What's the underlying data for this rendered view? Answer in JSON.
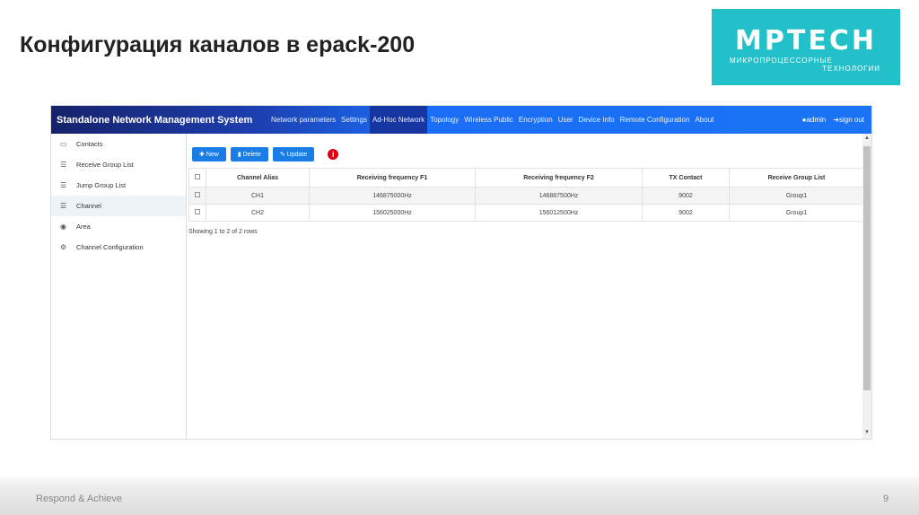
{
  "slide": {
    "title": "Конфигурация каналов в epack-200",
    "footer": "Respond & Achieve",
    "page": "9"
  },
  "logo": {
    "name": "MPTECH",
    "line1": "МИКРОПРОЦЕССОРНЫЕ",
    "line2": "ТЕХНОЛОГИИ"
  },
  "app": {
    "brand": "Standalone Network Management System",
    "nav": [
      "Network parameters",
      "Settings",
      "Ad-Hoc Network",
      "Topology",
      "Wireless Public",
      "Encryption",
      "User",
      "Device Info",
      "Remote Configuration",
      "About"
    ],
    "user": "admin",
    "signout": "sign out",
    "sidebar": [
      {
        "label": "Contacts",
        "icon": "▭"
      },
      {
        "label": "Receive Group List",
        "icon": "☰"
      },
      {
        "label": "Jump Group List",
        "icon": "☰"
      },
      {
        "label": "Channel",
        "icon": "☰"
      },
      {
        "label": "Area",
        "icon": "◉"
      },
      {
        "label": "Channel Configuration",
        "icon": "⚙"
      }
    ],
    "buttons": {
      "new": "New",
      "delete": "Delete",
      "update": "Update",
      "info": "i"
    },
    "columns": [
      "Channel Alias",
      "Receiving frequency F1",
      "Receiving frequency F2",
      "TX Contact",
      "Receive Group List"
    ],
    "rows": [
      [
        "CH1",
        "146875000Hz",
        "146887500Hz",
        "9002",
        "Group1"
      ],
      [
        "CH2",
        "156025000Hz",
        "156012500Hz",
        "9002",
        "Group1"
      ]
    ],
    "showing": "Showing 1 to 2 of 2 rows"
  }
}
